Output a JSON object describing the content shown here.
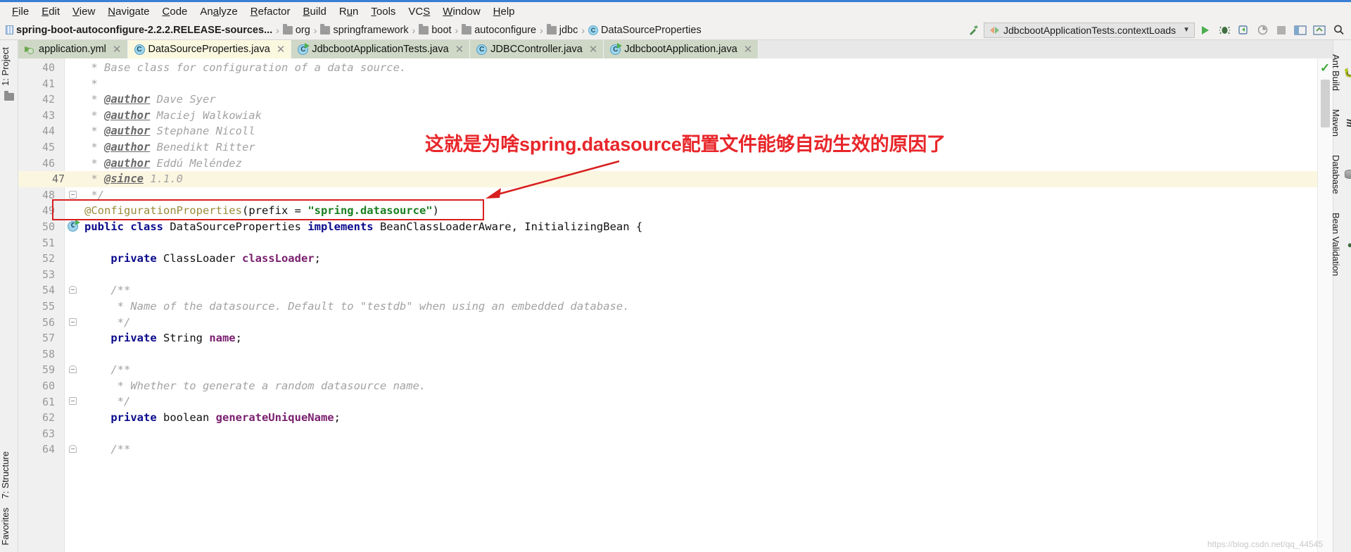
{
  "menu": {
    "items": [
      "File",
      "Edit",
      "View",
      "Navigate",
      "Code",
      "Analyze",
      "Refactor",
      "Build",
      "Run",
      "Tools",
      "VCS",
      "Window",
      "Help"
    ]
  },
  "breadcrumb": {
    "module": "spring-boot-autoconfigure-2.2.2.RELEASE-sources...",
    "separator": "›",
    "items": [
      {
        "label": "org",
        "icon": "folder-icon"
      },
      {
        "label": "springframework",
        "icon": "folder-icon"
      },
      {
        "label": "boot",
        "icon": "folder-icon"
      },
      {
        "label": "autoconfigure",
        "icon": "folder-icon"
      },
      {
        "label": "jdbc",
        "icon": "folder-icon"
      },
      {
        "label": "DataSourceProperties",
        "icon": "java-class-icon"
      }
    ]
  },
  "toolbar": {
    "run_configuration": "JdbcbootApplicationTests.contextLoads",
    "dropdown_icon": "chevron-down-icon",
    "buttons": [
      {
        "name": "make-project-button",
        "icon": "hammer-icon"
      },
      {
        "name": "run-button",
        "icon": "run-triangle-icon"
      },
      {
        "name": "debug-button",
        "icon": "debug-bug-icon"
      },
      {
        "name": "run-with-coverage-button",
        "icon": "coverage-icon"
      },
      {
        "name": "profile-button",
        "icon": "profiler-icon"
      },
      {
        "name": "stop-button",
        "icon": "stop-square-icon"
      },
      {
        "name": "toggle-layout-button",
        "icon": "layout-icon"
      },
      {
        "name": "update-button",
        "icon": "update-icon"
      },
      {
        "name": "search-everywhere-button",
        "icon": "search-icon"
      }
    ]
  },
  "tabs": [
    {
      "label": "application.yml",
      "icon": "yaml-icon",
      "active": false,
      "closable": true
    },
    {
      "label": "DataSourceProperties.java",
      "icon": "java-class-icon",
      "active": true,
      "closable": true
    },
    {
      "label": "JdbcbootApplicationTests.java",
      "icon": "java-runnable-class-icon",
      "active": false,
      "closable": true
    },
    {
      "label": "JDBCController.java",
      "icon": "java-class-icon",
      "active": false,
      "closable": true
    },
    {
      "label": "JdbcbootApplication.java",
      "icon": "java-runnable-class-icon",
      "active": false,
      "closable": true
    }
  ],
  "editor": {
    "caret_line": 47,
    "first_line_number": 40,
    "lines": [
      {
        "n": 40,
        "segments": [
          {
            "t": " * Base class for configuration of a data source.",
            "c": "cmt"
          }
        ]
      },
      {
        "n": 41,
        "segments": [
          {
            "t": " *",
            "c": "cmt"
          }
        ]
      },
      {
        "n": 42,
        "segments": [
          {
            "t": " * ",
            "c": "cmt"
          },
          {
            "t": "@author",
            "c": "tag"
          },
          {
            "t": " Dave Syer",
            "c": "cmt"
          }
        ]
      },
      {
        "n": 43,
        "segments": [
          {
            "t": " * ",
            "c": "cmt"
          },
          {
            "t": "@author",
            "c": "tag"
          },
          {
            "t": " Maciej Walkowiak",
            "c": "cmt"
          }
        ]
      },
      {
        "n": 44,
        "segments": [
          {
            "t": " * ",
            "c": "cmt"
          },
          {
            "t": "@author",
            "c": "tag"
          },
          {
            "t": " Stephane Nicoll",
            "c": "cmt"
          }
        ]
      },
      {
        "n": 45,
        "segments": [
          {
            "t": " * ",
            "c": "cmt"
          },
          {
            "t": "@author",
            "c": "tag"
          },
          {
            "t": " Benedikt Ritter",
            "c": "cmt"
          }
        ]
      },
      {
        "n": 46,
        "segments": [
          {
            "t": " * ",
            "c": "cmt"
          },
          {
            "t": "@author",
            "c": "tag"
          },
          {
            "t": " Eddú Meléndez",
            "c": "cmt"
          }
        ]
      },
      {
        "n": 47,
        "segments": [
          {
            "t": " * ",
            "c": "cmt"
          },
          {
            "t": "@since",
            "c": "tag"
          },
          {
            "t": " 1.1.0",
            "c": "cmt"
          }
        ]
      },
      {
        "n": 48,
        "segments": [
          {
            "t": " */",
            "c": "cmt"
          }
        ],
        "fold": "end"
      },
      {
        "n": 49,
        "segments": [
          {
            "t": "@ConfigurationProperties",
            "c": "anno"
          },
          {
            "t": "(",
            "c": "punc"
          },
          {
            "t": "prefix",
            "c": "plain"
          },
          {
            "t": " = ",
            "c": "punc"
          },
          {
            "t": "\"spring.datasource\"",
            "c": "str"
          },
          {
            "t": ")",
            "c": "punc"
          }
        ]
      },
      {
        "n": 50,
        "segments": [
          {
            "t": "public class",
            "c": "kw"
          },
          {
            "t": " DataSourceProperties ",
            "c": "plain"
          },
          {
            "t": "implements",
            "c": "kw"
          },
          {
            "t": " BeanClassLoaderAware, InitializingBean {",
            "c": "plain"
          }
        ],
        "marker": "run"
      },
      {
        "n": 51,
        "segments": [
          {
            "t": "",
            "c": "plain"
          }
        ]
      },
      {
        "n": 52,
        "segments": [
          {
            "t": "    ",
            "c": "plain"
          },
          {
            "t": "private",
            "c": "kw"
          },
          {
            "t": " ClassLoader ",
            "c": "plain"
          },
          {
            "t": "classLoader",
            "c": "field"
          },
          {
            "t": ";",
            "c": "punc"
          }
        ]
      },
      {
        "n": 53,
        "segments": [
          {
            "t": "",
            "c": "plain"
          }
        ]
      },
      {
        "n": 54,
        "segments": [
          {
            "t": "    /**",
            "c": "cmt"
          }
        ],
        "fold": "start"
      },
      {
        "n": 55,
        "segments": [
          {
            "t": "     * Name of the datasource. Default to \"testdb\" when using an embedded database.",
            "c": "cmt"
          }
        ]
      },
      {
        "n": 56,
        "segments": [
          {
            "t": "     */",
            "c": "cmt"
          }
        ],
        "fold": "end"
      },
      {
        "n": 57,
        "segments": [
          {
            "t": "    ",
            "c": "plain"
          },
          {
            "t": "private",
            "c": "kw"
          },
          {
            "t": " String ",
            "c": "plain"
          },
          {
            "t": "name",
            "c": "field"
          },
          {
            "t": ";",
            "c": "punc"
          }
        ]
      },
      {
        "n": 58,
        "segments": [
          {
            "t": "",
            "c": "plain"
          }
        ]
      },
      {
        "n": 59,
        "segments": [
          {
            "t": "    /**",
            "c": "cmt"
          }
        ],
        "fold": "start"
      },
      {
        "n": 60,
        "segments": [
          {
            "t": "     * Whether to generate a random datasource name.",
            "c": "cmt"
          }
        ]
      },
      {
        "n": 61,
        "segments": [
          {
            "t": "     */",
            "c": "cmt"
          }
        ],
        "fold": "end"
      },
      {
        "n": 62,
        "segments": [
          {
            "t": "    ",
            "c": "plain"
          },
          {
            "t": "private",
            "c": "kw"
          },
          {
            "t": " boolean ",
            "c": "plain"
          },
          {
            "t": "generateUniqueName",
            "c": "field"
          },
          {
            "t": ";",
            "c": "punc"
          }
        ]
      },
      {
        "n": 63,
        "segments": [
          {
            "t": "",
            "c": "plain"
          }
        ]
      },
      {
        "n": 64,
        "segments": [
          {
            "t": "    /**",
            "c": "cmt"
          }
        ],
        "fold": "start"
      }
    ]
  },
  "annotation": {
    "text": "这就是为啥spring.datasource配置文件能够自动生效的原因了",
    "color": "#e8262a",
    "box_color": "#d81e1e"
  },
  "left_strip": {
    "top": [
      {
        "label": "1: Project",
        "icon": "project-folder-icon"
      }
    ],
    "bottom": [
      {
        "label": "7: Structure",
        "icon": "structure-icon"
      },
      {
        "label": "Favorites",
        "icon": "favorites-icon"
      }
    ]
  },
  "right_strip": {
    "items": [
      {
        "label": "Ant Build",
        "icon": "ant-icon"
      },
      {
        "label": "Maven",
        "icon": "maven-icon"
      },
      {
        "label": "Database",
        "icon": "database-icon"
      },
      {
        "label": "Bean Validation",
        "icon": "bean-validation-icon"
      }
    ]
  },
  "status": {
    "inspection_icon": "green-check-icon",
    "watermark": "https://blog.csdn.net/qq_44545"
  }
}
